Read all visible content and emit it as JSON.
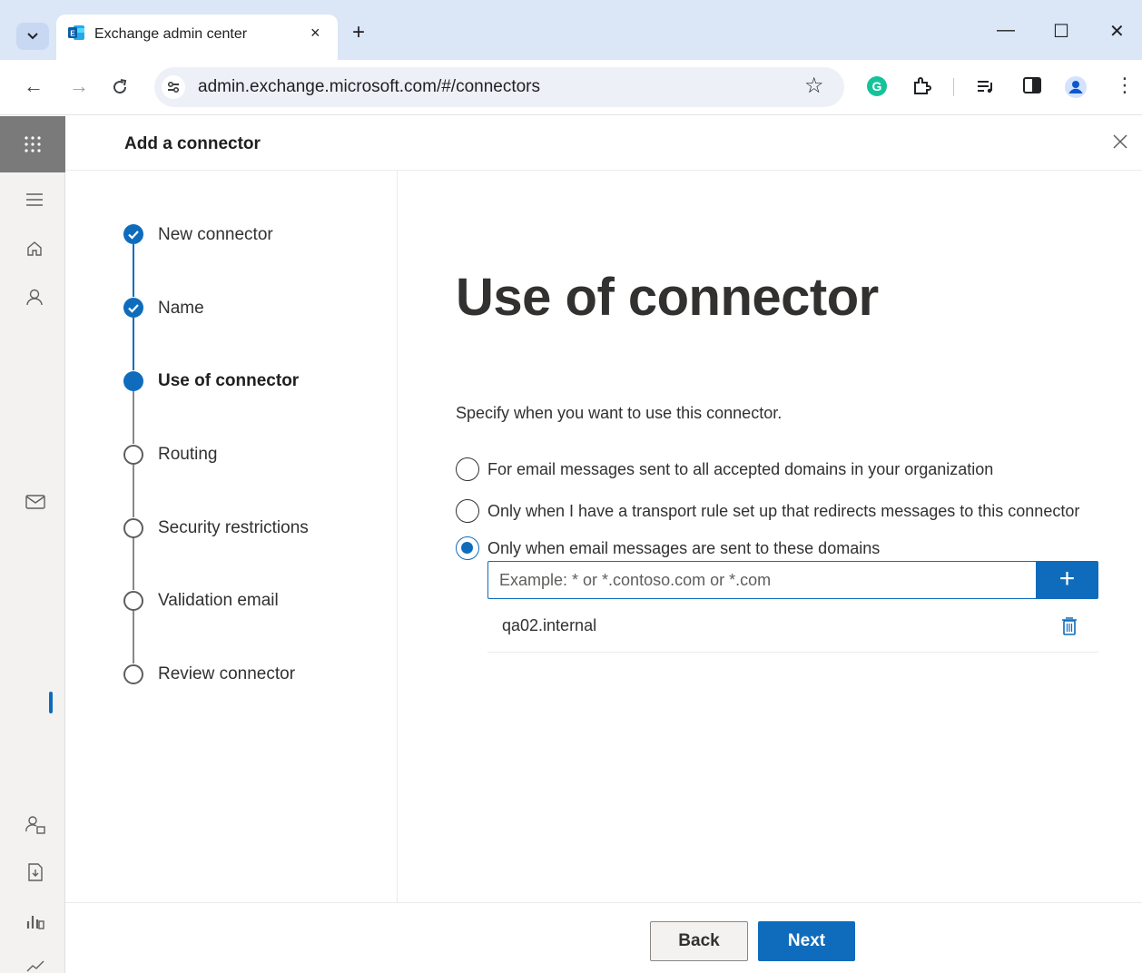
{
  "browser": {
    "tab_title": "Exchange admin center",
    "tab_close": "×",
    "new_tab": "+",
    "url": "admin.exchange.microsoft.com/#/connectors",
    "minimize": "—",
    "maximize": "☐",
    "close": "✕"
  },
  "panel": {
    "title": "Add a connector"
  },
  "steps": [
    {
      "label": "New connector",
      "state": "done"
    },
    {
      "label": "Name",
      "state": "done"
    },
    {
      "label": "Use of connector",
      "state": "current"
    },
    {
      "label": "Routing",
      "state": "todo"
    },
    {
      "label": "Security restrictions",
      "state": "todo"
    },
    {
      "label": "Validation email",
      "state": "todo"
    },
    {
      "label": "Review connector",
      "state": "todo"
    }
  ],
  "content": {
    "heading": "Use of connector",
    "description": "Specify when you want to use this connector.",
    "options": [
      {
        "label": "For email messages sent to all accepted domains in your organization",
        "checked": false
      },
      {
        "label": "Only when I have a transport rule set up that redirects messages to this connector",
        "checked": false
      },
      {
        "label": "Only when email messages are sent to these domains",
        "checked": true
      }
    ],
    "domain_input": {
      "value": "",
      "placeholder": "Example: * or *.contoso.com or *.com"
    },
    "add_button": "+",
    "domains": [
      "qa02.internal"
    ]
  },
  "footer": {
    "back": "Back",
    "next": "Next"
  },
  "colors": {
    "accent": "#0f6cbd",
    "tabbar": "#dbe6f7",
    "text": "#323130"
  },
  "icons": {
    "rail": [
      "app-launcher-icon",
      "hamburger-icon",
      "home-icon",
      "person-icon",
      "mail-icon",
      "user-lock-icon",
      "export-icon",
      "reports-icon",
      "trend-icon"
    ]
  }
}
